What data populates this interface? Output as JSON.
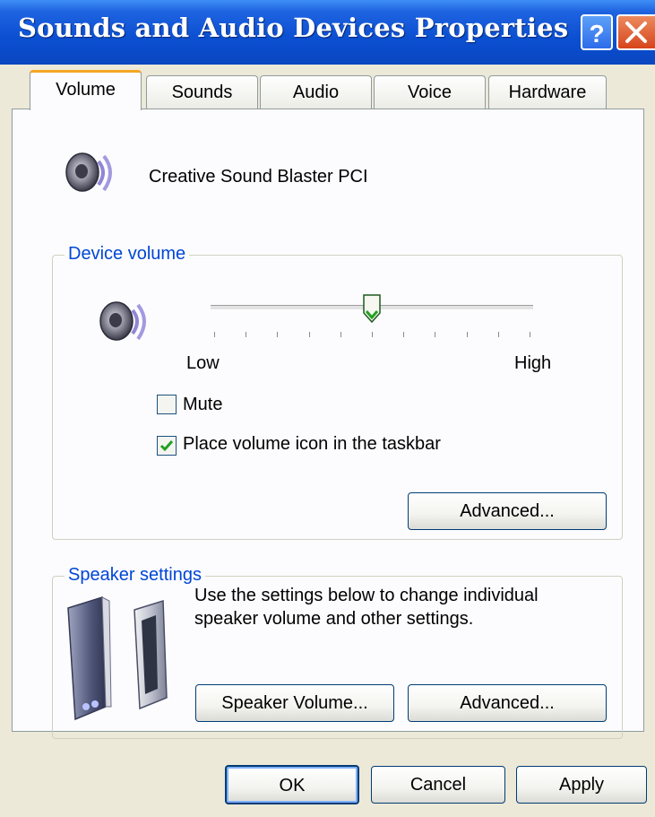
{
  "window": {
    "title": "Sounds and Audio Devices Properties"
  },
  "tabs": [
    {
      "label": "Volume",
      "active": true
    },
    {
      "label": "Sounds",
      "active": false
    },
    {
      "label": "Audio",
      "active": false
    },
    {
      "label": "Voice",
      "active": false
    },
    {
      "label": "Hardware",
      "active": false
    }
  ],
  "device": {
    "name": "Creative Sound Blaster PCI"
  },
  "device_volume": {
    "group_title": "Device volume",
    "low_label": "Low",
    "high_label": "High",
    "slider_level": 0.5,
    "mute_label": "Mute",
    "mute_checked": false,
    "taskbar_label": "Place volume icon in the taskbar",
    "taskbar_checked": true,
    "advanced_label": "Advanced..."
  },
  "speaker_settings": {
    "group_title": "Speaker settings",
    "description_line1": "Use the settings below to change individual",
    "description_line2": "speaker volume and other settings.",
    "speaker_volume_label": "Speaker Volume...",
    "advanced_label": "Advanced..."
  },
  "footer": {
    "ok_label": "OK",
    "cancel_label": "Cancel",
    "apply_label": "Apply"
  },
  "colors": {
    "title_bar": "#0b4fd1",
    "group_title": "#0046d5",
    "active_tab_accent": "#f5a623",
    "check_mark": "#21a121"
  }
}
